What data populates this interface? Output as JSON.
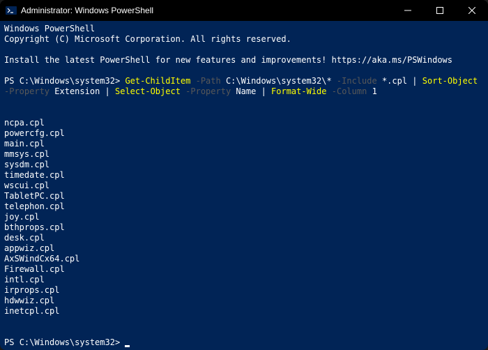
{
  "titlebar": {
    "title": "Administrator: Windows PowerShell"
  },
  "terminal": {
    "banner_line1": "Windows PowerShell",
    "banner_line2": "Copyright (C) Microsoft Corporation. All rights reserved.",
    "banner_line3": "Install the latest PowerShell for new features and improvements! https://aka.ms/PSWindows",
    "prompt1_prefix": "PS ",
    "prompt1_path": "C:\\Windows\\system32",
    "prompt1_suffix": ">",
    "cmd1": {
      "p1_cmd": "Get-ChildItem",
      "p1_param": "-Path",
      "p1_arg": "C:\\Windows\\system32\\*",
      "p2_param": "-Include",
      "p2_arg": "*.cpl",
      "pipe1": "|",
      "p3_cmd": "Sort-Object",
      "p3_param": "-Property",
      "p3_arg": "Extension",
      "pipe2": "|",
      "p4_cmd": "Select-Object",
      "p4_param": "-Property",
      "p4_arg": "Name",
      "pipe3": "|",
      "p5_cmd": "Format-Wide",
      "p5_param": "-Column",
      "p5_arg": "1"
    },
    "output": [
      "ncpa.cpl",
      "powercfg.cpl",
      "main.cpl",
      "mmsys.cpl",
      "sysdm.cpl",
      "timedate.cpl",
      "wscui.cpl",
      "TabletPC.cpl",
      "telephon.cpl",
      "joy.cpl",
      "bthprops.cpl",
      "desk.cpl",
      "appwiz.cpl",
      "AxSWindCx64.cpl",
      "Firewall.cpl",
      "intl.cpl",
      "irprops.cpl",
      "hdwwiz.cpl",
      "inetcpl.cpl"
    ],
    "prompt2_prefix": "PS ",
    "prompt2_path": "C:\\Windows\\system32",
    "prompt2_suffix": ">"
  }
}
